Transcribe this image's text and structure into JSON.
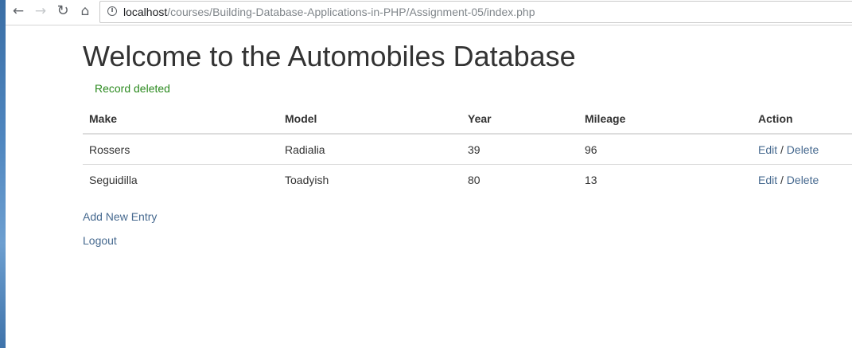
{
  "browser": {
    "url_host": "localhost",
    "url_path": "/courses/Building-Database-Applications-in-PHP/Assignment-05/index.php"
  },
  "page": {
    "title": "Welcome to the Automobiles Database",
    "flash": "Record deleted"
  },
  "table": {
    "headers": [
      "Make",
      "Model",
      "Year",
      "Mileage",
      "Action"
    ],
    "rows": [
      {
        "make": "Rossers",
        "model": "Radialia",
        "year": "39",
        "mileage": "96",
        "edit": "Edit",
        "sep": " / ",
        "delete": "Delete"
      },
      {
        "make": "Seguidilla",
        "model": "Toadyish",
        "year": "80",
        "mileage": "13",
        "edit": "Edit",
        "sep": " / ",
        "delete": "Delete"
      }
    ]
  },
  "links": {
    "add": "Add New Entry",
    "logout": "Logout"
  },
  "colors": {
    "link": "#46698f",
    "flash": "#2b8a1f"
  }
}
